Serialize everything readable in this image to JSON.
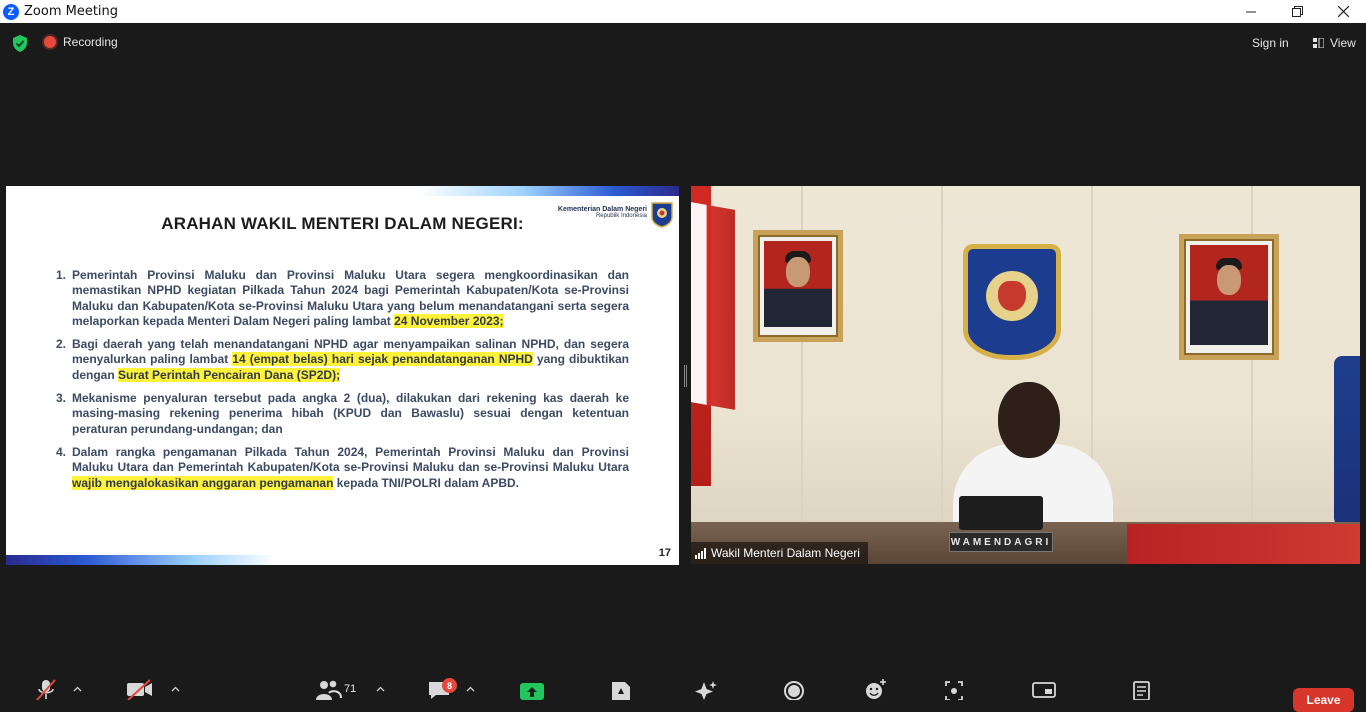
{
  "window": {
    "app_icon": "Z",
    "title": "Zoom Meeting"
  },
  "topbar": {
    "security_icon": "shield-check-icon",
    "recording_label": "Recording",
    "signin_label": "Sign in",
    "view_label": "View"
  },
  "slide": {
    "title": "ARAHAN WAKIL MENTERI DALAM NEGERI:",
    "logo_line1": "Kementerian Dalam Negeri",
    "logo_line2": "Republik Indonesia",
    "items": [
      {
        "num": "1.",
        "text": "Pemerintah Provinsi Maluku dan Provinsi Maluku Utara segera mengkoordinasikan dan memastikan NPHD kegiatan Pilkada Tahun 2024 bagi Pemerintah Kabupaten/Kota se-Provinsi Maluku dan Kabupaten/Kota se-Provinsi Maluku Utara yang belum menandatangani serta segera melaporkan kepada Menteri Dalam Negeri paling lambat ",
        "hl1": "24 November 2023;"
      },
      {
        "num": "2.",
        "text": "Bagi daerah yang telah menandatangani NPHD agar menyampaikan salinan NPHD, dan segera menyalurkan paling lambat ",
        "hl1": "14 (empat belas) hari sejak penandatanganan NPHD",
        "text2": " yang dibuktikan dengan ",
        "hl2": "Surat Perintah Pencairan Dana (SP2D);"
      },
      {
        "num": "3.",
        "text": "Mekanisme penyaluran tersebut pada angka 2 (dua), dilakukan dari rekening kas daerah ke masing-masing rekening penerima hibah (KPUD dan Bawaslu) sesuai dengan ketentuan peraturan perundang-undangan; dan"
      },
      {
        "num": "4.",
        "text": "Dalam rangka pengamanan Pilkada Tahun 2024, Pemerintah Provinsi Maluku dan Provinsi Maluku Utara dan Pemerintah Kabupaten/Kota se-Provinsi Maluku dan se-Provinsi Maluku Utara ",
        "hl1": "wajib mengalokasikan anggaran pengamanan",
        "text2": " kepada TNI/POLRI dalam APBD."
      }
    ],
    "page_number": "17"
  },
  "video": {
    "participant_name": "Wakil Menteri Dalam Negeri",
    "nameplate_text": "WAMENDAGRI"
  },
  "toolbar": {
    "participants_count": "71",
    "chat_badge": "8",
    "leave_label": "Leave",
    "colors": {
      "share": "#22c55e",
      "leave": "#d9362b",
      "badge": "#e5483c"
    }
  }
}
